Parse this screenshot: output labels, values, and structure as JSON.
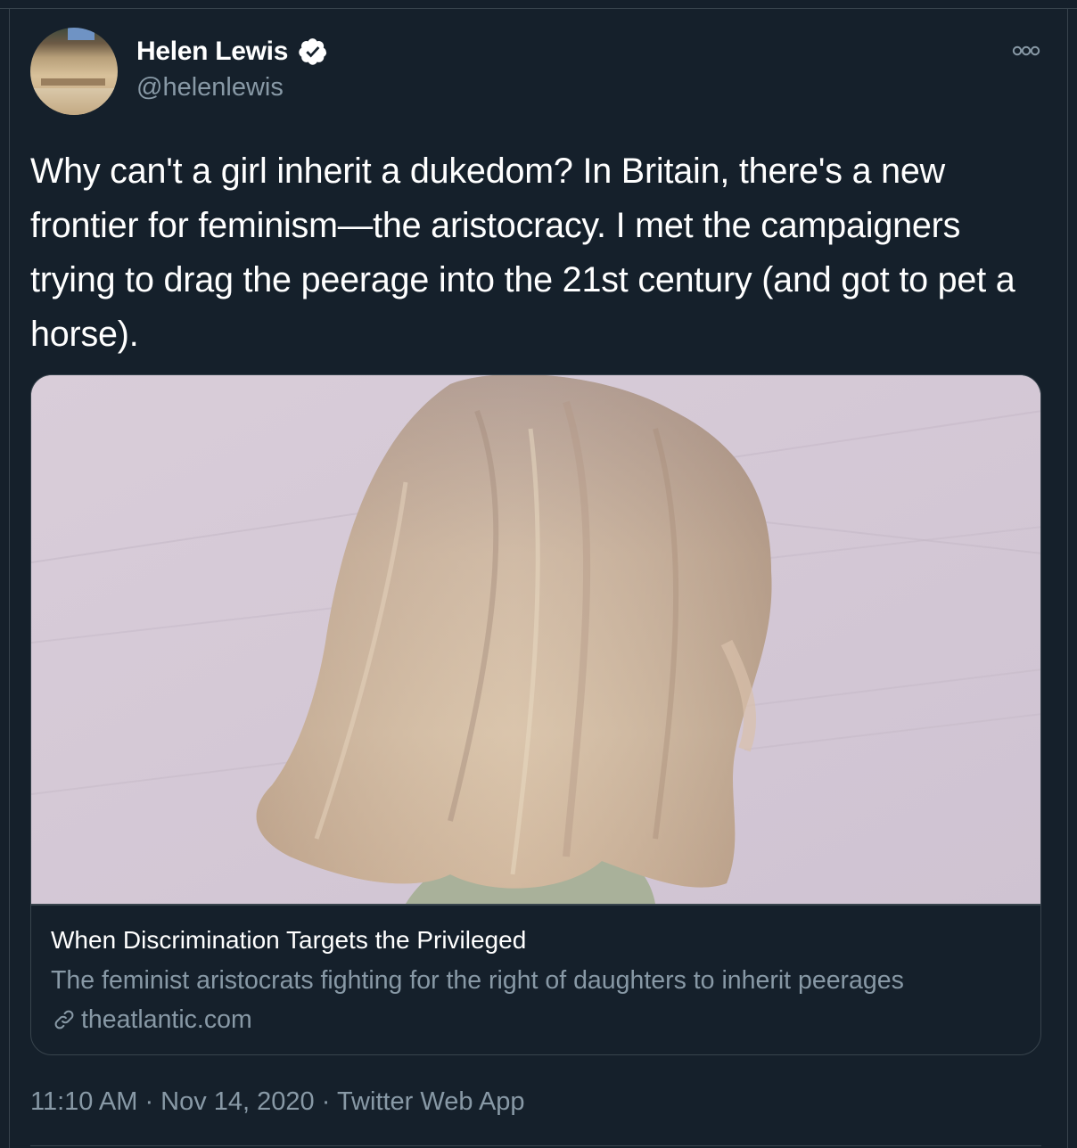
{
  "author": {
    "name": "Helen Lewis",
    "handle": "@helenlewis",
    "verified": true,
    "verified_icon": "verified-badge-icon",
    "avatar_icon": "avatar"
  },
  "menu": {
    "icon": "more-options-icon"
  },
  "tweet": {
    "text": "Why can't a girl inherit a dukedom? In Britain, there's a new frontier for feminism—the aristocracy. I met the campaigners trying to drag the peerage into the 21st century (and got to pet a horse)."
  },
  "card": {
    "title": "When Discrimination Targets the Privileged",
    "description": "The feminist aristocrats fighting for the right of daughters to inherit peerages",
    "domain": "theatlantic.com",
    "domain_icon": "link-icon"
  },
  "meta": {
    "time": "11:10 AM",
    "separator": " · ",
    "date": "Nov 14, 2020",
    "source": "Twitter Web App"
  },
  "colors": {
    "background": "#15202b",
    "border": "#38444d",
    "secondary_text": "#8899a6",
    "primary_text": "#ffffff"
  }
}
